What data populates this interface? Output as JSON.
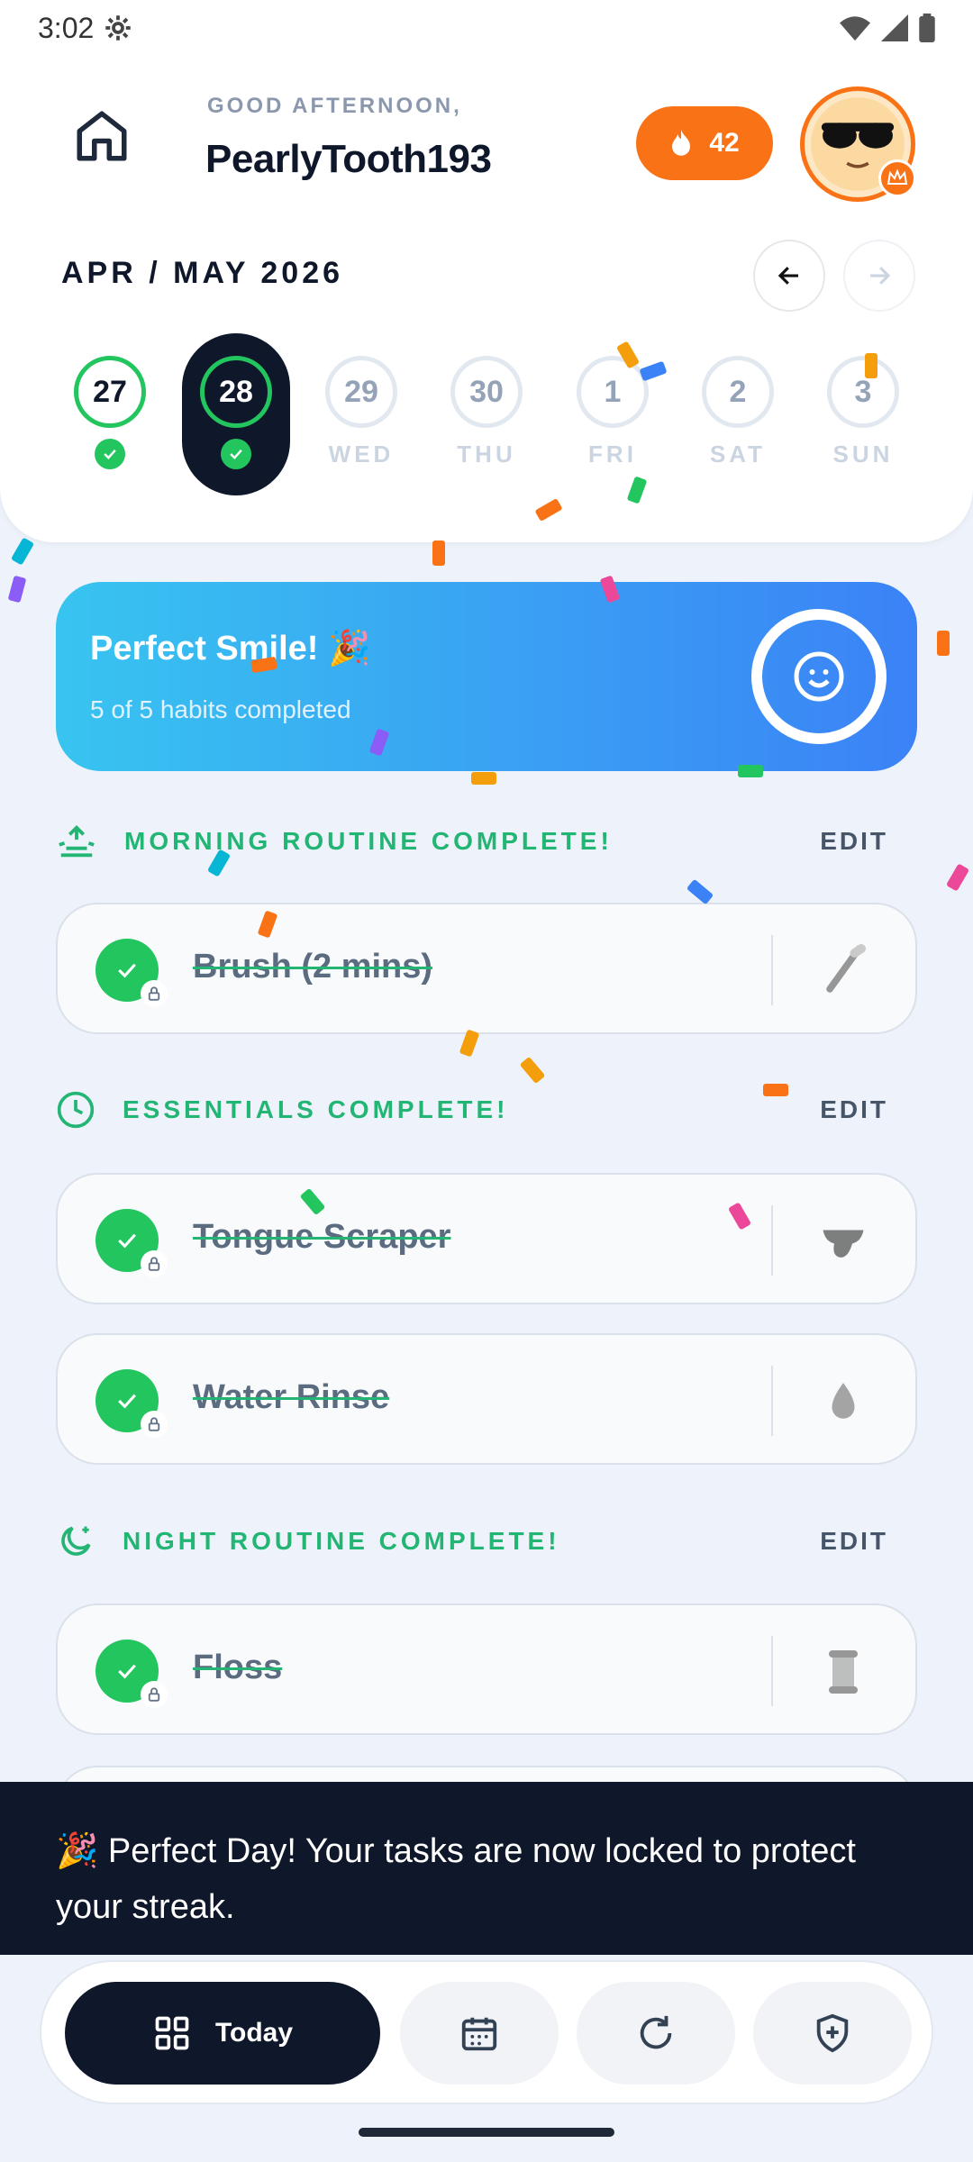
{
  "status_bar": {
    "time": "3:02"
  },
  "header": {
    "greeting": "GOOD AFTERNOON,",
    "username": "PearlyTooth193",
    "streak_count": "42",
    "month_label": "APR / MAY 2026"
  },
  "days": [
    {
      "num": "27",
      "name": "",
      "state": "done"
    },
    {
      "num": "28",
      "name": "",
      "state": "active"
    },
    {
      "num": "29",
      "name": "WED",
      "state": "future"
    },
    {
      "num": "30",
      "name": "THU",
      "state": "future"
    },
    {
      "num": "1",
      "name": "FRI",
      "state": "future"
    },
    {
      "num": "2",
      "name": "SAT",
      "state": "future"
    },
    {
      "num": "3",
      "name": "SUN",
      "state": "future"
    }
  ],
  "banner": {
    "title": "Perfect Smile! 🎉",
    "subtitle": "5 of 5 habits completed"
  },
  "sections": {
    "morning": {
      "label": "MORNING ROUTINE COMPLETE!",
      "edit": "EDIT"
    },
    "essentials": {
      "label": "ESSENTIALS COMPLETE!",
      "edit": "EDIT"
    },
    "night": {
      "label": "NIGHT ROUTINE COMPLETE!",
      "edit": "EDIT"
    }
  },
  "tasks": {
    "brush": {
      "name": "Brush (2 mins)",
      "icon": "toothbrush-icon"
    },
    "tongue": {
      "name": "Tongue Scraper",
      "icon": "tongue-icon"
    },
    "water": {
      "name": "Water Rinse",
      "icon": "droplet-icon"
    },
    "floss": {
      "name": "Floss",
      "icon": "thread-spool-icon"
    }
  },
  "snackbar": {
    "message": "🎉 Perfect Day! Your tasks are now locked to protect your streak."
  },
  "bottom_nav": {
    "today_label": "Today"
  },
  "colors": {
    "accent_green": "#22c55e",
    "streak_orange": "#f97316",
    "dark": "#0f172a",
    "banner_start": "#38c4f0",
    "banner_end": "#3b82f6"
  }
}
